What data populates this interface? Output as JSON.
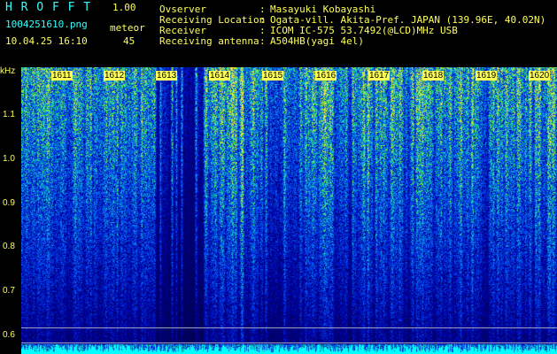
{
  "app": {
    "name": "H R O F F T",
    "version": "1.00"
  },
  "file": {
    "name": "1004251610.png",
    "datetime": "10.04.25 16:10"
  },
  "meteor": {
    "label": "meteor",
    "count": "45"
  },
  "info": [
    {
      "key": "Ovserver",
      "sep": ":",
      "value": "Masayuki Kobayashi"
    },
    {
      "key": "Receiving Location",
      "sep": ":",
      "value": "Ogata-vill. Akita-Pref. JAPAN (139.96E, 40.02N)"
    },
    {
      "key": "Receiver",
      "sep": ":",
      "value": "ICOM IC-575 53.7492(@LCD)MHz USB"
    },
    {
      "key": "Receiving antenna",
      "sep": ":",
      "value": "A504HB(yagi 4el)"
    }
  ],
  "axis": {
    "unit": "kHz",
    "y_labels": [
      "1.1",
      "1.0",
      "0.9",
      "0.8",
      "0.7",
      "0.6"
    ],
    "time_ticks": [
      "1611",
      "1612",
      "1613",
      "1614",
      "1615",
      "1616",
      "1617",
      "1618",
      "1619",
      "1620"
    ]
  },
  "colors": {
    "text_yellow": "#ffff55",
    "text_cyan": "#33ffff",
    "background": "#000000"
  }
}
